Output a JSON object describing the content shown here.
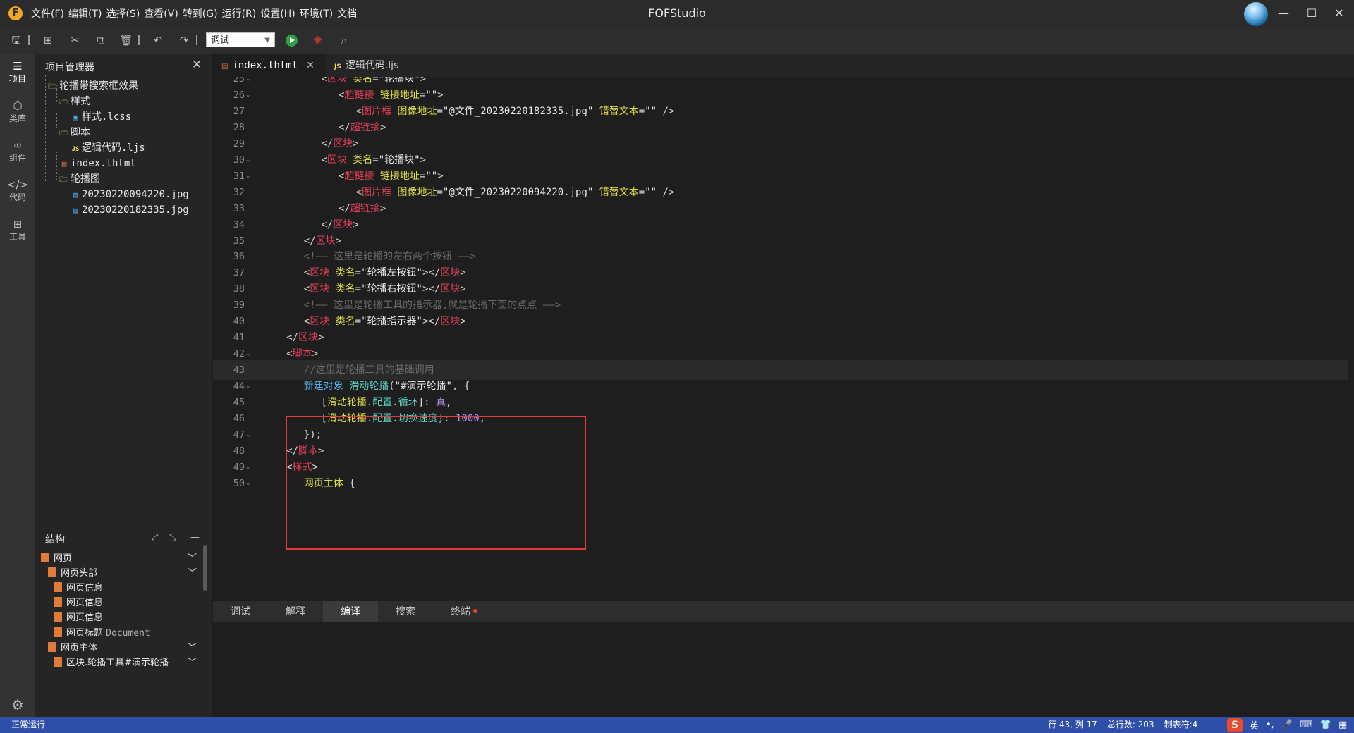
{
  "window": {
    "title": "FOFStudio",
    "logo": "F",
    "menu": [
      "文件(F)",
      "编辑(T)",
      "选择(S)",
      "查看(V)",
      "转到(G)",
      "运行(R)",
      "设置(H)",
      "环境(T)",
      "文档"
    ]
  },
  "toolbar": {
    "mode_value": "调试"
  },
  "activity_bar": [
    {
      "label": "项目",
      "icon": "layers-icon"
    },
    {
      "label": "类库",
      "icon": "cube-icon"
    },
    {
      "label": "组件",
      "icon": "link-icon"
    },
    {
      "label": "代码",
      "icon": "code-icon"
    },
    {
      "label": "工具",
      "icon": "tools-icon"
    }
  ],
  "explorer": {
    "title": "项目管理器",
    "items": [
      {
        "label": "轮播带搜索框效果",
        "type": "folder"
      },
      {
        "label": "样式",
        "type": "folder"
      },
      {
        "label": "样式.lcss",
        "type": "css"
      },
      {
        "label": "脚本",
        "type": "folder"
      },
      {
        "label": "逻辑代码.ljs",
        "type": "js"
      },
      {
        "label": "index.lhtml",
        "type": "html"
      },
      {
        "label": "轮播图",
        "type": "folder"
      },
      {
        "label": "20230220094220.jpg",
        "type": "jpg"
      },
      {
        "label": "20230220182335.jpg",
        "type": "jpg"
      }
    ]
  },
  "structure": {
    "title": "结构",
    "items": [
      {
        "label": "网页",
        "sub": ""
      },
      {
        "label": "网页头部",
        "sub": ""
      },
      {
        "label": "网页信息",
        "sub": ""
      },
      {
        "label": "网页信息",
        "sub": ""
      },
      {
        "label": "网页信息",
        "sub": ""
      },
      {
        "label": "网页标题",
        "sub": "Document"
      },
      {
        "label": "网页主体",
        "sub": ""
      },
      {
        "label": "区块.轮播工具#演示轮播",
        "sub": ""
      }
    ]
  },
  "tabs": [
    {
      "label": "index.lhtml",
      "icon": "html",
      "active": true
    },
    {
      "label": "逻辑代码.ljs",
      "icon": "JS",
      "active": false
    }
  ],
  "code": {
    "current_line": 43,
    "lines": [
      {
        "n": "25",
        "fold": true
      },
      {
        "n": "26",
        "fold": true
      },
      {
        "n": "27",
        "fold": false
      },
      {
        "n": "28",
        "fold": false
      },
      {
        "n": "29",
        "fold": false
      },
      {
        "n": "30",
        "fold": true
      },
      {
        "n": "31",
        "fold": true
      },
      {
        "n": "32",
        "fold": false
      },
      {
        "n": "33",
        "fold": false
      },
      {
        "n": "34",
        "fold": false
      },
      {
        "n": "35",
        "fold": false
      },
      {
        "n": "36",
        "fold": false
      },
      {
        "n": "37",
        "fold": false
      },
      {
        "n": "38",
        "fold": false
      },
      {
        "n": "39",
        "fold": false
      },
      {
        "n": "40",
        "fold": false
      },
      {
        "n": "41",
        "fold": false
      },
      {
        "n": "42",
        "fold": true
      },
      {
        "n": "43",
        "fold": false
      },
      {
        "n": "44",
        "fold": true
      },
      {
        "n": "45",
        "fold": false
      },
      {
        "n": "46",
        "fold": false
      },
      {
        "n": "47",
        "fold": true
      },
      {
        "n": "48",
        "fold": false
      },
      {
        "n": "49",
        "fold": true
      },
      {
        "n": "50",
        "fold": true
      }
    ],
    "t": {
      "block": "区块",
      "link": "超链接",
      "image": "图片框",
      "script": "脚本",
      "style": "样式",
      "class_attr": "类名",
      "href_attr": "链接地址",
      "src_attr": "图像地址",
      "alt_attr": "错替文本",
      "cls_slide": "\"轮播块\"",
      "empty": "\"\"",
      "img1": "\"@文件_20230220182335.jpg\"",
      "img2": "\"@文件_20230220094220.jpg\"",
      "cls_left": "\"轮播左按钮\"",
      "cls_right": "\"轮播右按钮\"",
      "cls_indicator": "\"轮播指示器\"",
      "cmt36": "<!—— 这里是轮播的左右两个按钮 ——>",
      "cmt39": "<!—— 这里是轮播工具的指示器,就是轮播下面的点点 ——>",
      "cmt43": "//这里是轮播工具的基础调用",
      "new_obj": "新建对象",
      "slider": "滑动轮播",
      "sel": "\"#演示轮播\"",
      "cfg_slider": "滑动轮播",
      "cfg": "配置",
      "loop": "循环",
      "speed": "切换速度",
      "true_val": "真",
      "speed_val": "1000",
      "body_sel": "网页主体"
    }
  },
  "panel_tabs": [
    {
      "label": "调试",
      "dot": false
    },
    {
      "label": "解释",
      "dot": false
    },
    {
      "label": "编译",
      "dot": false,
      "active": true
    },
    {
      "label": "搜索",
      "dot": false
    },
    {
      "label": "终端",
      "dot": true
    }
  ],
  "status": {
    "left": "正常运行",
    "position": "行 43, 列 17",
    "total_lines": "总行数: 203",
    "tab_size": "制表符:4",
    "ime_lang": "英"
  },
  "colors": {
    "statusbar": "#2f4ea8",
    "highlight_box": "#e33b3b",
    "run_button": "#2ea043"
  }
}
